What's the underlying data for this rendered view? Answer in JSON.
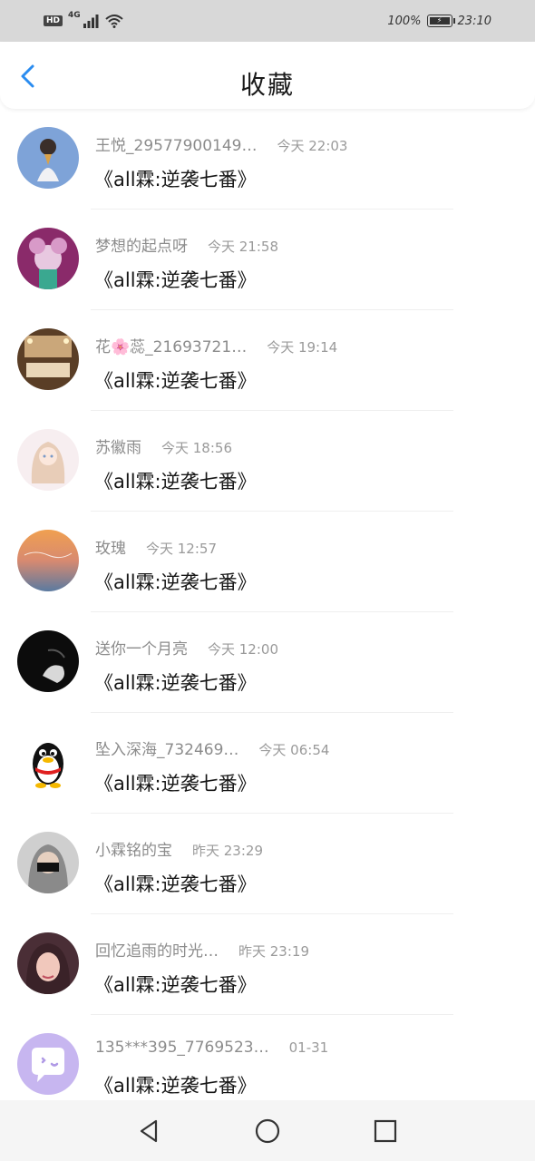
{
  "status_bar": {
    "hd": "HD",
    "network": "4G",
    "battery": "100%",
    "time": "23:10"
  },
  "header": {
    "title": "收藏",
    "back_icon": "chevron-left-icon"
  },
  "accent_color": "#2a8cf0",
  "items": [
    {
      "name": "王悦_29577900149…",
      "time": "今天 22:03",
      "title": "《all霖:逆袭七番》",
      "avatar_colors": [
        "#7a9fd8",
        "#2e4a8a"
      ]
    },
    {
      "name": "梦想的起点呀",
      "time": "今天 21:58",
      "title": "《all霖:逆袭七番》",
      "avatar_colors": [
        "#8a2a6a",
        "#c9a0c8"
      ]
    },
    {
      "name": "花🌸蕊_21693721…",
      "time": "今天 19:14",
      "title": "《all霖:逆袭七番》",
      "avatar_colors": [
        "#6b4a2a",
        "#d9b98a"
      ]
    },
    {
      "name": "苏徽雨",
      "time": "今天 18:56",
      "title": "《all霖:逆袭七番》",
      "avatar_colors": [
        "#f6e9ee",
        "#e4c8d0"
      ]
    },
    {
      "name": "玫瑰",
      "time": "今天 12:57",
      "title": "《all霖:逆袭七番》",
      "avatar_colors": [
        "#e8a060",
        "#6a86a8"
      ]
    },
    {
      "name": "送你一个月亮",
      "time": "今天 12:00",
      "title": "《all霖:逆袭七番》",
      "avatar_colors": [
        "#0a0a0a",
        "#4a4a4a"
      ]
    },
    {
      "name": "坠入深海_732469…",
      "time": "今天 06:54",
      "title": "《all霖:逆袭七番》",
      "avatar_colors": [
        "#ffffff",
        "#ffffff"
      ]
    },
    {
      "name": "小霖铭的宝",
      "time": "昨天 23:29",
      "title": "《all霖:逆袭七番》",
      "avatar_colors": [
        "#b8b8b8",
        "#5a5a5a"
      ]
    },
    {
      "name": "回忆追雨的时光…",
      "time": "昨天 23:19",
      "title": "《all霖:逆袭七番》",
      "avatar_colors": [
        "#5a3a44",
        "#d8a8a0"
      ]
    },
    {
      "name": "135***395_7769523…",
      "time": "01-31",
      "title": "《all霖:逆袭七番》",
      "avatar_colors": [
        "#c9b8f0",
        "#b09ae6"
      ]
    }
  ],
  "nav_bar": {
    "back": "triangle-back-icon",
    "home": "circle-home-icon",
    "recents": "square-recents-icon"
  }
}
